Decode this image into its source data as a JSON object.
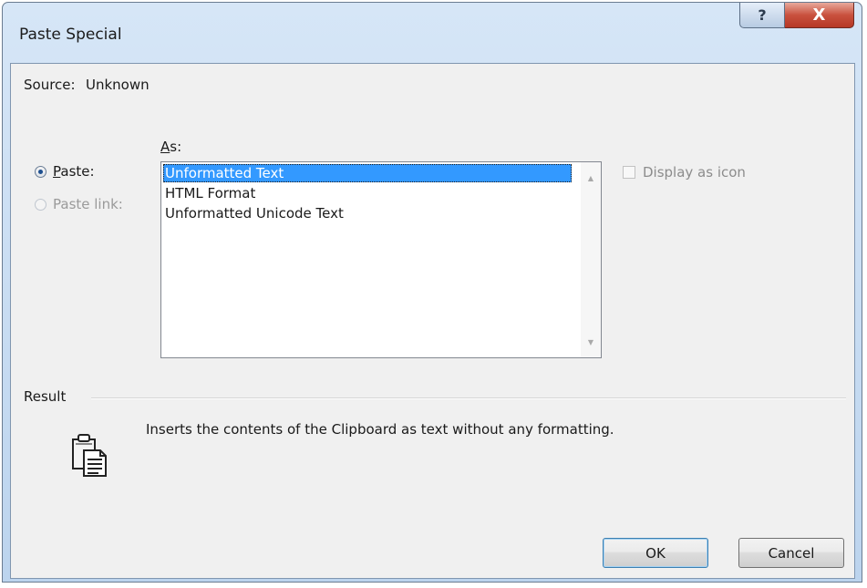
{
  "window": {
    "title": "Paste Special",
    "help_button": "?",
    "close_button": "X"
  },
  "source": {
    "label": "Source:",
    "value": "Unknown"
  },
  "as_section": {
    "label_underlined": "A",
    "label_rest": "s:",
    "items": [
      "Unformatted Text",
      "HTML Format",
      "Unformatted Unicode Text"
    ],
    "selected_index": 0
  },
  "options": {
    "paste": {
      "underlined": "P",
      "rest": "aste:",
      "checked": true,
      "enabled": true
    },
    "paste_link": {
      "label": "Paste link:",
      "checked": false,
      "enabled": false
    }
  },
  "display_as_icon": {
    "label": "Display as icon",
    "checked": false,
    "enabled": false
  },
  "result": {
    "label": "Result",
    "text": "Inserts the contents of the Clipboard as text without any formatting."
  },
  "buttons": {
    "ok": "OK",
    "cancel": "Cancel"
  },
  "icons": {
    "help": "help-icon",
    "close": "close-icon",
    "clipboard": "clipboard-icon",
    "scroll_up": "arrow-up-icon",
    "scroll_down": "arrow-down-icon"
  },
  "colors": {
    "selection": "#3399ff",
    "close_button": "#c9513e",
    "dialog_face": "#f0f0f0"
  }
}
